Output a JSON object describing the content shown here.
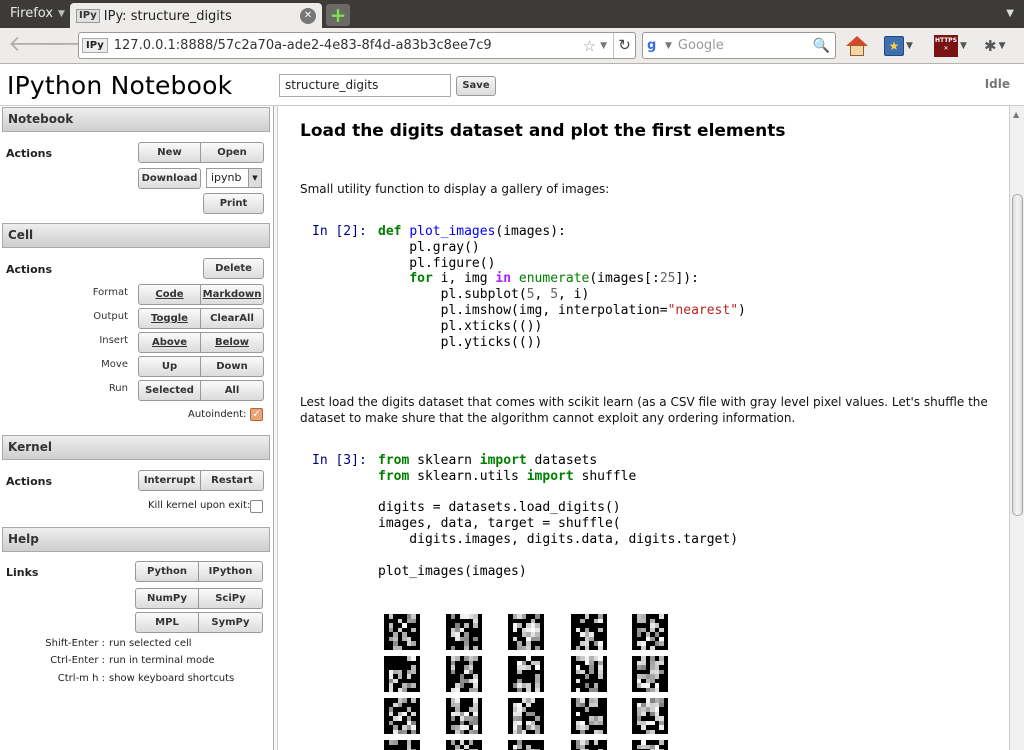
{
  "browser": {
    "app_menu": "Firefox",
    "tab_title": "IPy: structure_digits",
    "tab_badge": "IPy",
    "url_badge": "IPy",
    "url": "127.0.0.1:8888/57c2a70a-ade2-4e83-8f4d-a83b3c8ee7c9",
    "search_placeholder": "Google",
    "https_label": "HTTPS"
  },
  "header": {
    "title": "IPython Notebook",
    "notebook_name": "structure_digits",
    "save_label": "Save",
    "kernel_status": "Idle"
  },
  "sidebar": {
    "notebook": {
      "title": "Notebook",
      "actions_label": "Actions",
      "new": "New",
      "open": "Open",
      "download": "Download",
      "format_value": "ipynb",
      "print": "Print"
    },
    "cell": {
      "title": "Cell",
      "actions_label": "Actions",
      "delete": "Delete",
      "format_label": "Format",
      "code": "Code",
      "markdown": "Markdown",
      "output_label": "Output",
      "toggle": "Toggle",
      "clearall": "ClearAll",
      "insert_label": "Insert",
      "above": "Above",
      "below": "Below",
      "move_label": "Move",
      "up": "Up",
      "down": "Down",
      "run_label": "Run",
      "selected": "Selected",
      "all": "All",
      "autoindent_label": "Autoindent:"
    },
    "kernel": {
      "title": "Kernel",
      "actions_label": "Actions",
      "interrupt": "Interrupt",
      "restart": "Restart",
      "kill_label": "Kill kernel upon exit:"
    },
    "help": {
      "title": "Help",
      "links_label": "Links",
      "python": "Python",
      "ipython": "IPython",
      "numpy": "NumPy",
      "scipy": "SciPy",
      "mpl": "MPL",
      "sympy": "SymPy",
      "shortcuts": [
        {
          "key": "Shift-Enter :",
          "desc": "run selected cell"
        },
        {
          "key": "Ctrl-Enter :",
          "desc": "run in terminal mode"
        },
        {
          "key": "Ctrl-m h :",
          "desc": "show keyboard shortcuts"
        }
      ]
    }
  },
  "notebook": {
    "heading": "Load the digits dataset and plot the first elements",
    "md1": "Small utility function to display a gallery of images:",
    "prompt1": "In [2]:",
    "prompt2": "In [3]:",
    "md2": "Lest load the digits dataset that comes with scikit learn (as a CSV file with gray level pixel values. Let's shuffle the dataset to make shure that the algorithm cannot exploit any ordering information.",
    "code1": [
      "def plot_images(images):",
      "    pl.gray()",
      "    pl.figure()",
      "    for i, img in enumerate(images[:25]):",
      "        pl.subplot(5, 5, i)",
      "        pl.imshow(img, interpolation=\"nearest\")",
      "        pl.xticks(())",
      "        pl.yticks(())"
    ],
    "code2": [
      "from sklearn import datasets",
      "from sklearn.utils import shuffle",
      "",
      "digits = datasets.load_digits()",
      "images, data, target = shuffle(",
      "    digits.images, digits.data, digits.target)",
      "",
      "plot_images(images)"
    ]
  },
  "colors": {
    "keyword": "#008000",
    "string": "#ba2121",
    "prompt": "#000080",
    "tabbar": "#3c3b37"
  }
}
